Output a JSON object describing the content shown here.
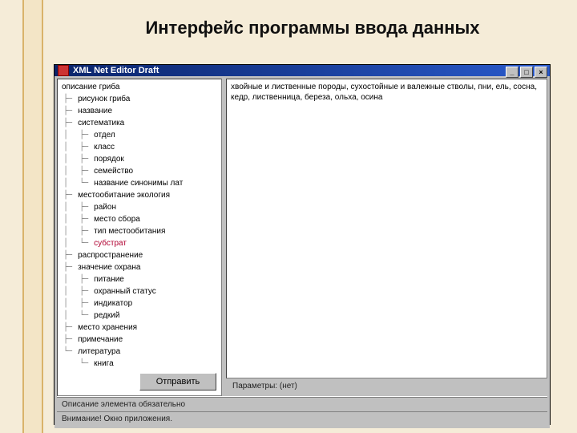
{
  "slide": {
    "title": "Интерфейс программы ввода данных"
  },
  "window": {
    "title": "XML Net Editor Draft"
  },
  "tree": {
    "root": "описание гриба",
    "items": [
      {
        "label": "рисунок гриба",
        "depth": 1
      },
      {
        "label": "название",
        "depth": 1
      },
      {
        "label": "систематика",
        "depth": 1
      },
      {
        "label": "отдел",
        "depth": 2
      },
      {
        "label": "класс",
        "depth": 2
      },
      {
        "label": "порядок",
        "depth": 2
      },
      {
        "label": "семейство",
        "depth": 2
      },
      {
        "label": "название синонимы лат",
        "depth": 2
      },
      {
        "label": "местообитание экология",
        "depth": 1
      },
      {
        "label": "район",
        "depth": 2
      },
      {
        "label": "место сбора",
        "depth": 2
      },
      {
        "label": "тип местообитания",
        "depth": 2
      },
      {
        "label": "субстрат",
        "depth": 2,
        "selected": true
      },
      {
        "label": "распространение",
        "depth": 1
      },
      {
        "label": "значение охрана",
        "depth": 1
      },
      {
        "label": "питание",
        "depth": 2
      },
      {
        "label": "охранный статус",
        "depth": 2
      },
      {
        "label": "индикатор",
        "depth": 2
      },
      {
        "label": "редкий",
        "depth": 2
      },
      {
        "label": "место хранения",
        "depth": 1
      },
      {
        "label": "примечание",
        "depth": 1
      },
      {
        "label": "литература",
        "depth": 1
      },
      {
        "label": "книга",
        "depth": 2
      }
    ]
  },
  "buttons": {
    "submit": "Отправить"
  },
  "content": {
    "text": "хвойные и лиственные породы, сухостойные и валежные стволы, пни, ель, сосна, кедр, лиственница, береза, ольха, осина"
  },
  "params": {
    "label": "Параметры: (нет)"
  },
  "status": {
    "line1": "Описание элемента обязательно",
    "line2": "Внимание! Окно приложения."
  }
}
